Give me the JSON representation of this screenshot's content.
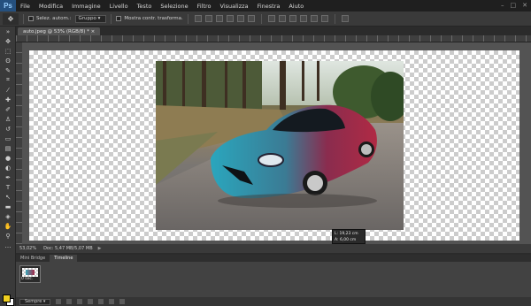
{
  "menubar": {
    "logo": "Ps",
    "items": [
      "File",
      "Modifica",
      "Immagine",
      "Livello",
      "Testo",
      "Selezione",
      "Filtro",
      "Visualizza",
      "Finestra",
      "Aiuto"
    ]
  },
  "options": {
    "auto_select_label": "Selez. autom.:",
    "auto_select_target": "Gruppo",
    "show_transform_label": "Mostra contr. trasforma."
  },
  "document": {
    "tab_title": "auto.jpeg @ 53% (RGB/8) *"
  },
  "info_tip": {
    "width_label": "L:",
    "width_value": "19,23 cm",
    "height_label": "A:",
    "height_value": "6,00 cm"
  },
  "status": {
    "zoom": "53,02%",
    "doc_size": "Doc: 5,47 MB/5,07 MB"
  },
  "panel": {
    "tabs": [
      "Mini Bridge",
      "Timeline"
    ],
    "active_tab": "Timeline",
    "frame_duration": "0 sec.",
    "loop": "Sempre"
  },
  "colors": {
    "foreground": "#f0d020",
    "background": "#ffffff",
    "accent": "#25507e"
  }
}
